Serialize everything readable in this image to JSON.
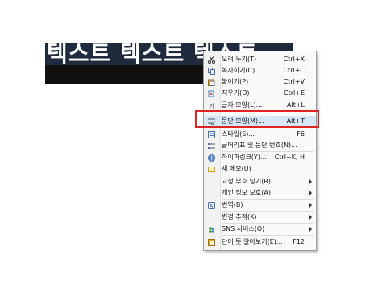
{
  "document": {
    "selected_text": "텍스트 텍스트 텍스트"
  },
  "context_menu": {
    "items": [
      {
        "label": "오려 두기(T)",
        "shortcut": "Ctrl+X",
        "icon": "scissors-icon"
      },
      {
        "label": "복사하기(C)",
        "shortcut": "Ctrl+C",
        "icon": "copy-icon"
      },
      {
        "label": "붙이기(P)",
        "shortcut": "Ctrl+V",
        "icon": "paste-icon"
      },
      {
        "label": "지우기(D)",
        "shortcut": "Ctrl+E",
        "icon": "erase-icon"
      },
      {
        "label": "글자 모양(L)...",
        "shortcut": "Alt+L",
        "icon": "char-shape-icon"
      },
      {
        "label": "문단 모양(M)...",
        "shortcut": "Alt+T",
        "icon": "paragraph-shape-icon"
      },
      {
        "label": "스타일(S)...",
        "shortcut": "F6",
        "icon": "style-icon"
      },
      {
        "label": "글머리표 및 문단 번호(N)...",
        "shortcut": "",
        "icon": "bullets-icon"
      },
      {
        "label": "하이퍼링크(Y)...",
        "shortcut": "Ctrl+K, H",
        "icon": "hyperlink-icon"
      },
      {
        "label": "새 메모(U)",
        "shortcut": "",
        "icon": "memo-icon"
      },
      {
        "label": "교정 부호 넣기(R)",
        "shortcut": "",
        "icon": ""
      },
      {
        "label": "개인 정보 보호(A)",
        "shortcut": "",
        "icon": ""
      },
      {
        "label": "번역(B)",
        "shortcut": "",
        "icon": "translate-icon"
      },
      {
        "label": "변경 추적(K)",
        "shortcut": "",
        "icon": ""
      },
      {
        "label": "SNS 서비스(O)",
        "shortcut": "",
        "icon": "sns-icon"
      },
      {
        "label": "단어 뜻 알아보기(E)...",
        "shortcut": "F12",
        "icon": "dictionary-icon"
      }
    ]
  },
  "highlighted_item": "문단 모양(M)...",
  "colors": {
    "highlight_border": "#e02323",
    "selection_background": "#1f2a3d",
    "menu_background": "#fafafa"
  }
}
